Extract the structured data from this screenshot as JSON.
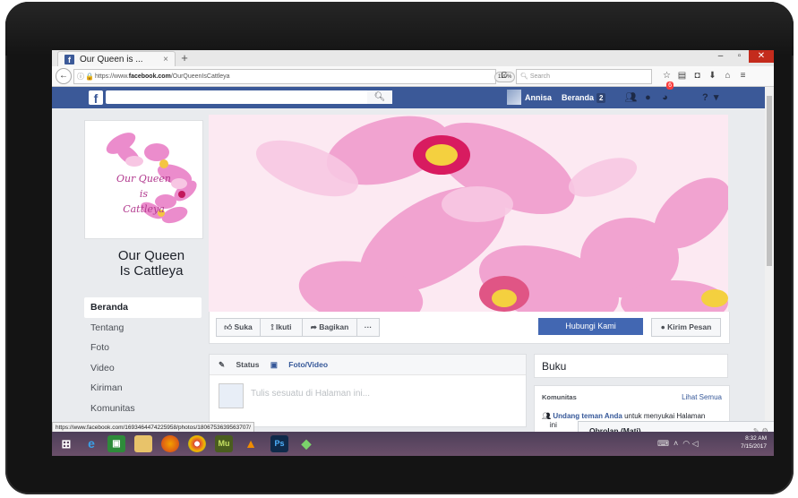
{
  "browser": {
    "tab_title": "Our Queen is ...",
    "tab_close": "×",
    "new_tab": "+",
    "url_prefix": "https://www.",
    "url_domain": "facebook.com",
    "url_path": "/OurQueenIsCattleya",
    "zoom": "120%",
    "search_placeholder": "Search",
    "status_url": "https://www.facebook.com/1693464474225958/photos/1806753639563707/"
  },
  "facebook": {
    "user_name": "Annisa",
    "home_label": "Beranda",
    "home_count": "2",
    "notif_count": "6",
    "page_name_line1": "Our Queen",
    "page_name_line2": "Is Cattleya",
    "profile_script": [
      "Our Queen",
      "is",
      "Cattleya"
    ],
    "left_nav": [
      "Beranda",
      "Tentang",
      "Foto",
      "Video",
      "Kiriman",
      "Komunitas"
    ],
    "actions": {
      "like": "Suka",
      "follow": "Ikuti",
      "share": "Bagikan",
      "more": "···"
    },
    "contact_button": "Hubungi Kami",
    "message_button": "Kirim Pesan",
    "composer": {
      "status_tab": "Status",
      "photo_tab": "Foto/Video",
      "placeholder": "Tulis sesuatu di Halaman ini..."
    },
    "buku": "Buku",
    "komunitas": {
      "heading": "Komunitas",
      "see_all": "Lihat Semua",
      "invite_link": "Undang teman Anda",
      "invite_rest": " untuk menyukai Halaman",
      "invite_line2": "ini"
    },
    "chat_label": "Obrolan (Mati)"
  },
  "taskbar": {
    "time": "8:32 AM",
    "date": "7/15/2017"
  },
  "colors": {
    "facebook_blue": "#3b5998",
    "button_blue": "#4267b2",
    "cover_pink": "#f0a8d2"
  }
}
